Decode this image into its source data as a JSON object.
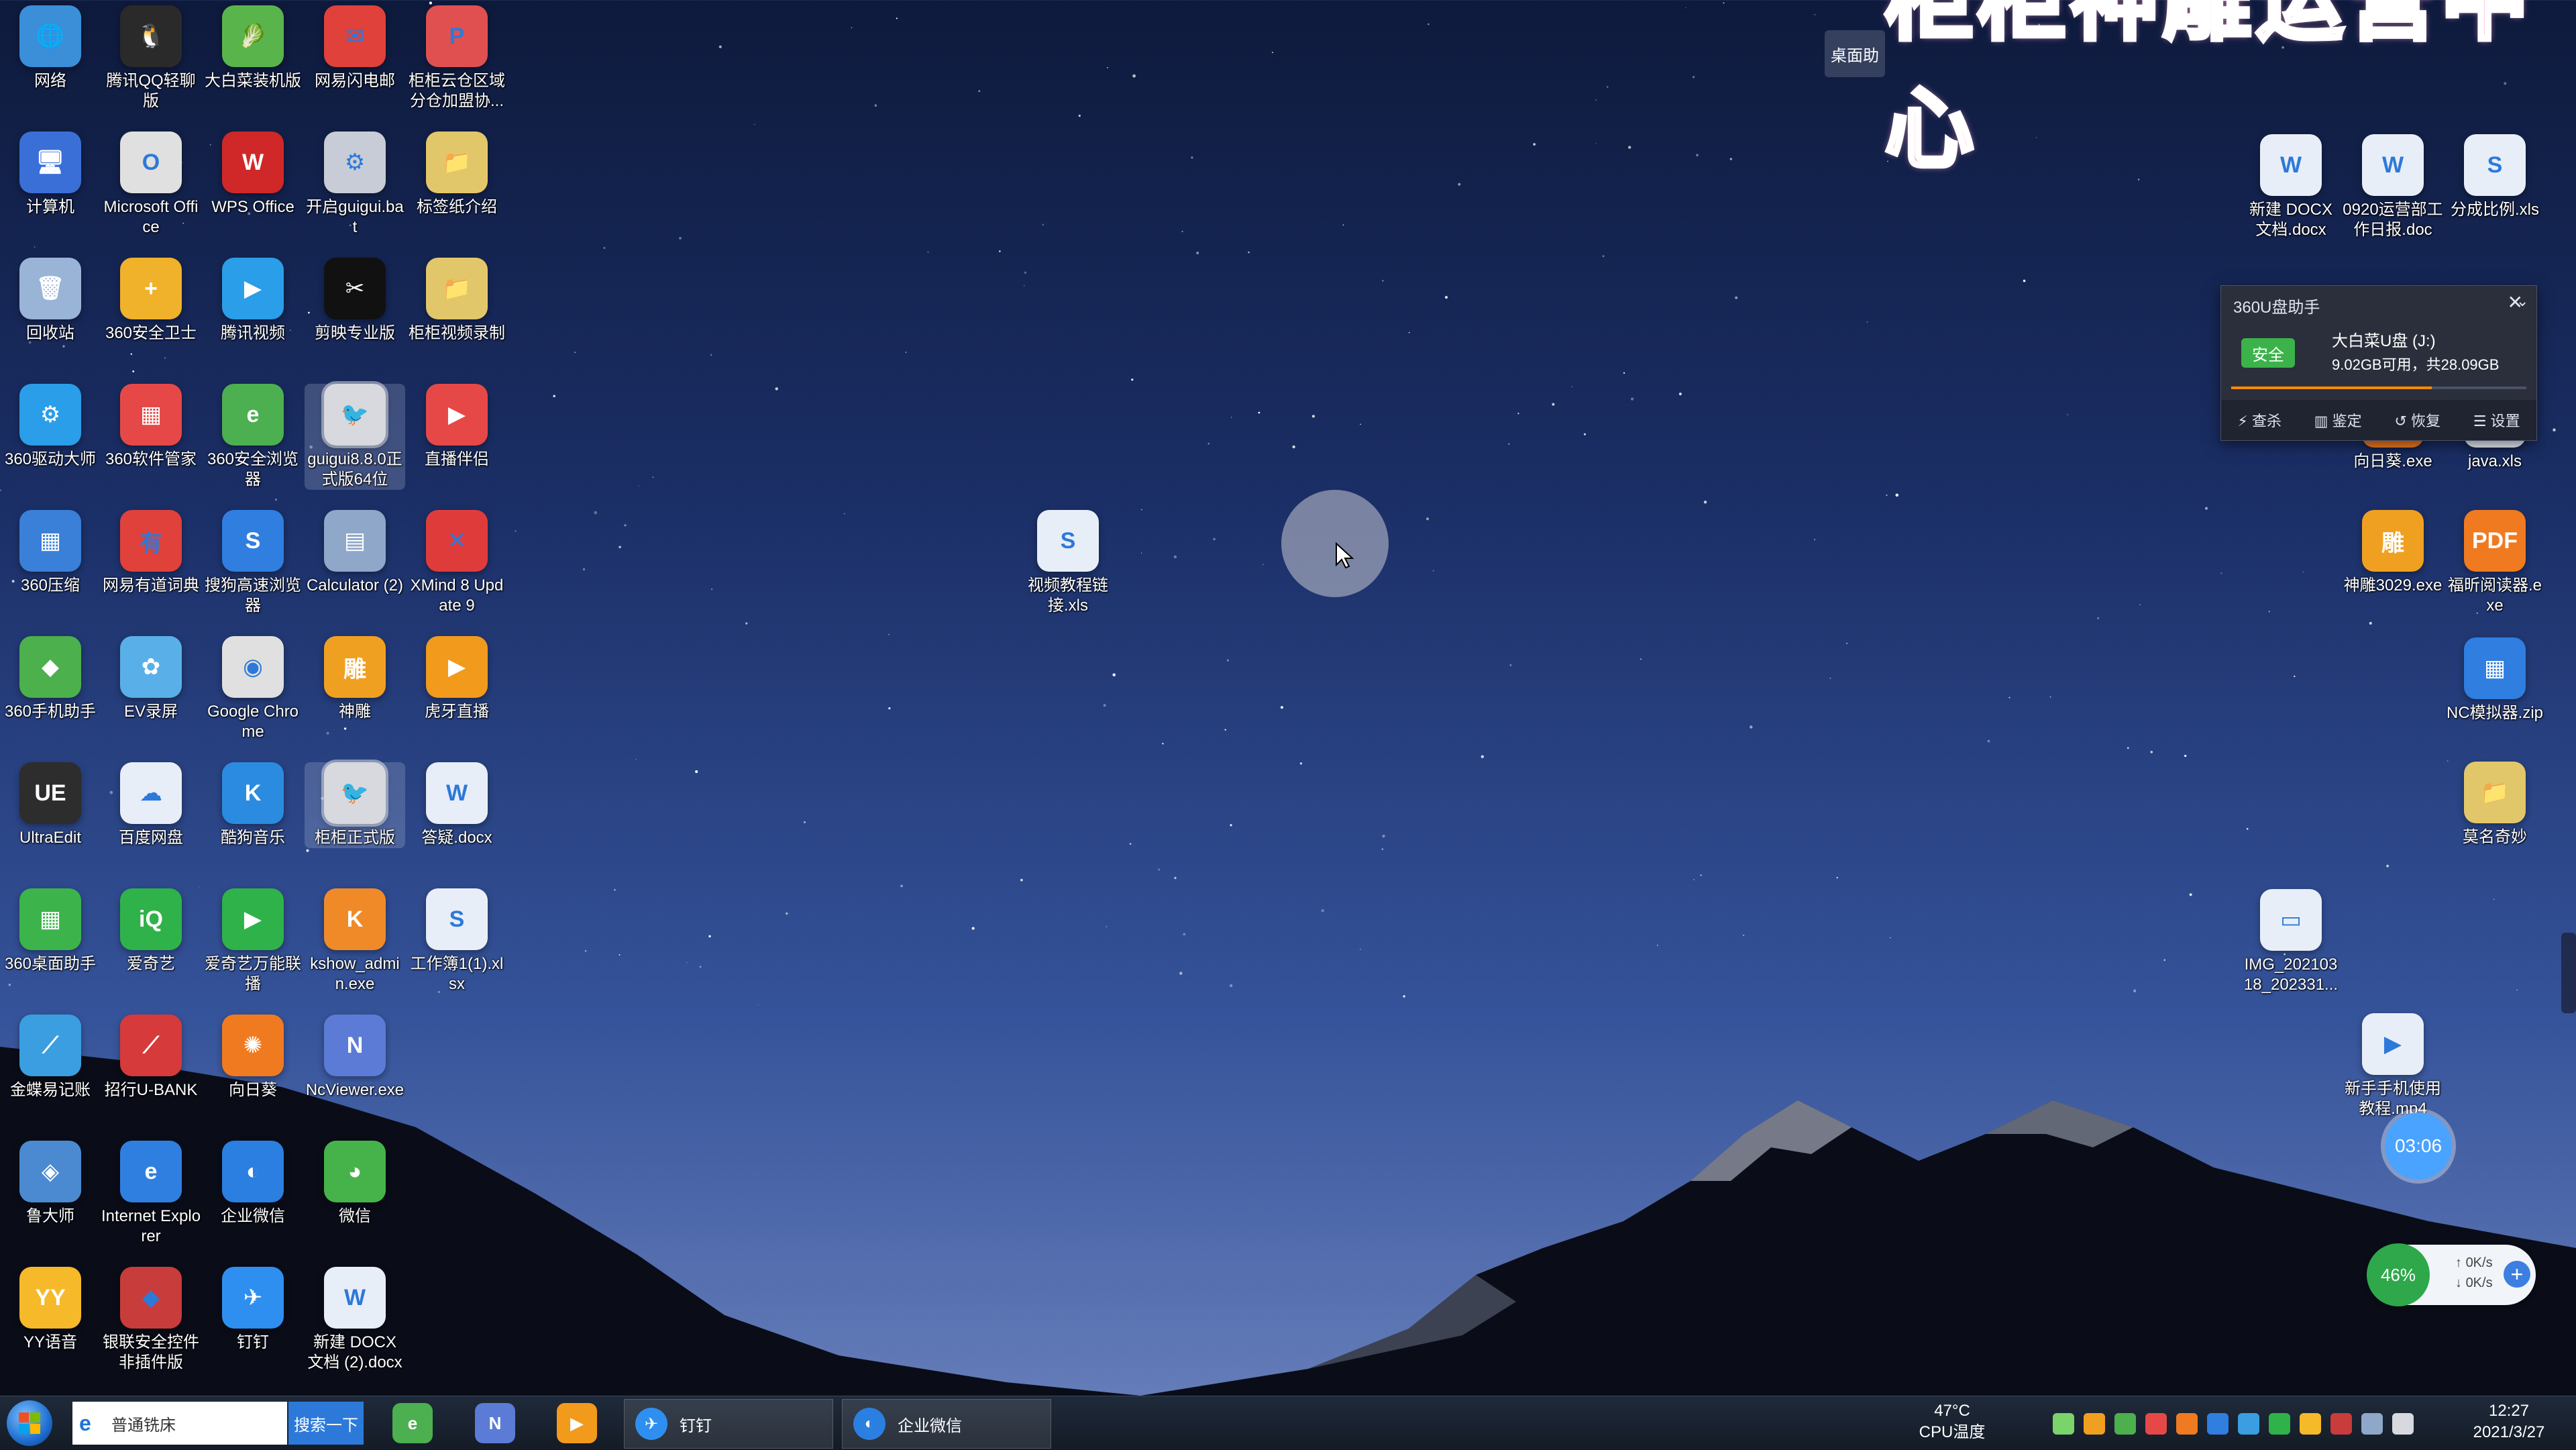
{
  "banner": {
    "text": "柜柜神雕运营中心"
  },
  "side_tab": {
    "label": "桌面助"
  },
  "desktop": {
    "left_icons": [
      {
        "label": "网络",
        "color": "#3a8fd8",
        "glyph": "🌐"
      },
      {
        "label": "腾讯QQ轻聊版",
        "color": "#2a2a2a",
        "glyph": "🐧"
      },
      {
        "label": "大白菜装机版",
        "color": "#59b54b",
        "glyph": "🥬"
      },
      {
        "label": "网易闪电邮",
        "color": "#e0413b",
        "glyph": "✉"
      },
      {
        "label": "柜柜云仓区域分仓加盟协...",
        "color": "#e05050",
        "glyph": "P"
      },
      {
        "label": "计算机",
        "color": "#3a6fd8",
        "glyph": "🖥"
      },
      {
        "label": "Microsoft Office",
        "color": "#e0e0e0",
        "glyph": "O"
      },
      {
        "label": "WPS Office",
        "color": "#d02828",
        "glyph": "W"
      },
      {
        "label": "开启guigui.bat",
        "color": "#c8ccd6",
        "glyph": "⚙"
      },
      {
        "label": "标签纸介绍",
        "color": "#e2c76a",
        "glyph": "📁"
      },
      {
        "label": "回收站",
        "color": "#9ab4d8",
        "glyph": "🗑"
      },
      {
        "label": "360安全卫士",
        "color": "#f0b12b",
        "glyph": "+"
      },
      {
        "label": "腾讯视频",
        "color": "#2a9ee8",
        "glyph": "▶"
      },
      {
        "label": "剪映专业版",
        "color": "#111111",
        "glyph": "✂"
      },
      {
        "label": "柜柜视频录制",
        "color": "#e2c76a",
        "glyph": "📁"
      },
      {
        "label": "360驱动大师",
        "color": "#2a9ee8",
        "glyph": "⚙"
      },
      {
        "label": "360软件管家",
        "color": "#e64848",
        "glyph": "▦"
      },
      {
        "label": "360安全浏览器",
        "color": "#4caf50",
        "glyph": "e"
      },
      {
        "label": "guigui8.8.0正式版64位",
        "color": "#d7d9de",
        "glyph": "🐦"
      },
      {
        "label": "直播伴侣",
        "color": "#e64848",
        "glyph": "▶"
      },
      {
        "label": "360压缩",
        "color": "#3a7fd8",
        "glyph": "▦"
      },
      {
        "label": "网易有道词典",
        "color": "#e0413b",
        "glyph": "有"
      },
      {
        "label": "搜狗高速浏览器",
        "color": "#2f7ee0",
        "glyph": "S"
      },
      {
        "label": "Calculator (2)",
        "color": "#8fa7c8",
        "glyph": "▤"
      },
      {
        "label": "XMind 8 Update 9",
        "color": "#e03b3b",
        "glyph": "✕"
      },
      {
        "label": "360手机助手",
        "color": "#4cb04c",
        "glyph": "◆"
      },
      {
        "label": "EV录屏",
        "color": "#59b0e8",
        "glyph": "✿"
      },
      {
        "label": "Google Chrome",
        "color": "#e0e0e0",
        "glyph": "◉"
      },
      {
        "label": "神雕",
        "color": "#f0a020",
        "glyph": "雕"
      },
      {
        "label": "虎牙直播",
        "color": "#f29a1c",
        "glyph": "▶"
      },
      {
        "label": "UltraEdit",
        "color": "#2d2d2d",
        "glyph": "UE"
      },
      {
        "label": "百度网盘",
        "color": "#e8eef8",
        "glyph": "☁"
      },
      {
        "label": "酷狗音乐",
        "color": "#2b8be0",
        "glyph": "K"
      },
      {
        "label": "柜柜正式版",
        "color": "#d7d9de",
        "glyph": "🐦"
      },
      {
        "label": "答疑.docx",
        "color": "#e8eef8",
        "glyph": "W"
      },
      {
        "label": "360桌面助手",
        "color": "#3cb44b",
        "glyph": "▦"
      },
      {
        "label": "爱奇艺",
        "color": "#2fb24a",
        "glyph": "iQ"
      },
      {
        "label": "爱奇艺万能联播",
        "color": "#2fb24a",
        "glyph": "▶"
      },
      {
        "label": "kshow_admin.exe",
        "color": "#f08a28",
        "glyph": "K"
      },
      {
        "label": "工作簿1(1).xlsx",
        "color": "#e8eef8",
        "glyph": "S"
      },
      {
        "label": "金蝶易记账",
        "color": "#3a9ee0",
        "glyph": "⟋"
      },
      {
        "label": "招行U-BANK",
        "color": "#d63a3a",
        "glyph": "⟋"
      },
      {
        "label": "向日葵",
        "color": "#f07a20",
        "glyph": "✺"
      },
      {
        "label": "NcViewer.exe",
        "color": "#5b7bd6",
        "glyph": "N"
      },
      {
        "label": "",
        "color": "",
        "glyph": ""
      },
      {
        "label": "鲁大师",
        "color": "#4b8ad0",
        "glyph": "◈"
      },
      {
        "label": "Internet Explorer",
        "color": "#2f7fe0",
        "glyph": "e"
      },
      {
        "label": "企业微信",
        "color": "#2a7fe0",
        "glyph": "◐"
      },
      {
        "label": "微信",
        "color": "#46b34a",
        "glyph": "◕"
      },
      {
        "label": "",
        "color": "",
        "glyph": ""
      },
      {
        "label": "YY语音",
        "color": "#f5b92a",
        "glyph": "YY"
      },
      {
        "label": "银联安全控件非插件版",
        "color": "#c83c3c",
        "glyph": "◆"
      },
      {
        "label": "钉钉",
        "color": "#2f8ff0",
        "glyph": "✈"
      },
      {
        "label": "新建 DOCX 文档 (2).docx",
        "color": "#e8eef8",
        "glyph": "W"
      },
      {
        "label": "",
        "color": "",
        "glyph": ""
      }
    ],
    "middle_icons": [
      {
        "label": "视频教程链接.xls",
        "color": "#e8eef8",
        "glyph": "S"
      }
    ],
    "right_icons": [
      {
        "label": "新建 DOCX 文档.docx",
        "color": "#e8eef8",
        "glyph": "W"
      },
      {
        "label": "0920运营部工作日报.doc",
        "color": "#e8eef8",
        "glyph": "W"
      },
      {
        "label": "分成比例.xls",
        "color": "#e8eef8",
        "glyph": "S"
      },
      {
        "label": "向日葵.exe",
        "color": "#f07a20",
        "glyph": "✺"
      },
      {
        "label": "java.xls",
        "color": "#e8eef8",
        "glyph": "S"
      },
      {
        "label": "神雕3029.exe",
        "color": "#f0a020",
        "glyph": "雕"
      },
      {
        "label": "福昕阅读器.exe",
        "color": "#f07a20",
        "glyph": "PDF"
      },
      {
        "label": "NC模拟器.zip",
        "color": "#2f7ee0",
        "glyph": "▦"
      },
      {
        "label": "莫名奇妙",
        "color": "#e2c76a",
        "glyph": "📁"
      },
      {
        "label": "IMG_20210318_202331...",
        "color": "#e8eef8",
        "glyph": "▭"
      },
      {
        "label": "新手手机使用教程.mp4",
        "color": "#e8eef8",
        "glyph": "▶"
      }
    ]
  },
  "usb_panel": {
    "title": "360U盘助手",
    "badge": "安全",
    "drive": "大白菜U盘 (J:)",
    "space": "9.02GB可用，共28.09GB",
    "used_fraction": 0.68,
    "actions": [
      "查杀",
      "鉴定",
      "恢复",
      "设置"
    ]
  },
  "timer": {
    "text": "03:06"
  },
  "netmon": {
    "percent": "46%",
    "up": "0K/s",
    "down": "0K/s"
  },
  "taskbar": {
    "search_value": "普通铣床",
    "search_button": "搜索一下",
    "tasks": [
      {
        "label": "钉钉",
        "icon_color": "#2f8ff0",
        "glyph": "✈"
      },
      {
        "label": "企业微信",
        "icon_color": "#2a7fe0",
        "glyph": "◐"
      }
    ],
    "temp_value": "47°C",
    "temp_label": "CPU温度",
    "time": "12:27",
    "date": "2021/3/27"
  }
}
